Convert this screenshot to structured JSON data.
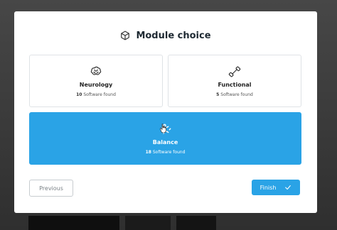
{
  "modal": {
    "title": "Module choice",
    "title_icon": "cube-icon"
  },
  "cards": [
    {
      "name": "Neurology",
      "count": "10",
      "count_label": "Software found",
      "icon": "brain-icon",
      "selected": false
    },
    {
      "name": "Functional",
      "count": "5",
      "count_label": "Software found",
      "icon": "dumbbell-icon",
      "selected": false
    },
    {
      "name": "Balance",
      "count": "18",
      "count_label": "Software found",
      "icon": "balance-figure-icon",
      "selected": true
    }
  ],
  "footer": {
    "previous_label": "Previous",
    "finish_label": "Finish"
  },
  "colors": {
    "accent": "#2aa3e6",
    "border": "#dfe3e6",
    "title": "#1f2a33"
  }
}
